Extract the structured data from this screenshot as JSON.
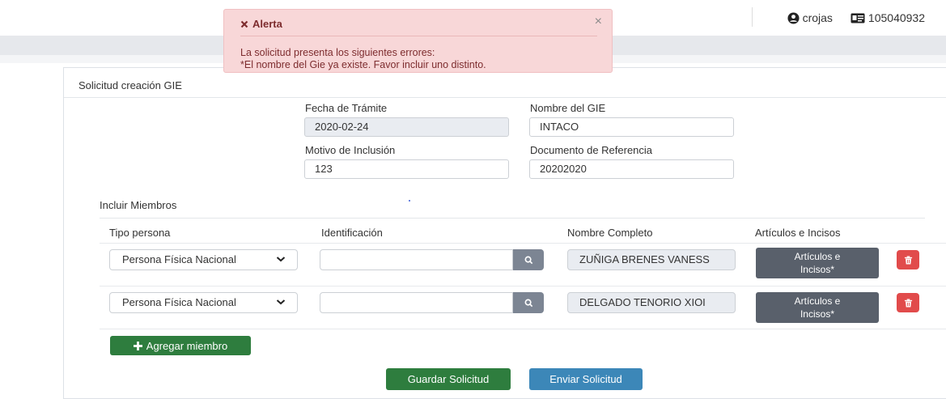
{
  "header": {
    "username": "crojas",
    "id_number": "105040932"
  },
  "alert": {
    "title": "Alerta",
    "close": "×",
    "line1": "La solicitud presenta los siguientes errores:",
    "line2": "*El nombre del Gie ya existe. Favor incluir uno distinto."
  },
  "form": {
    "card_title": "Solicitud creación GIE",
    "fecha_label": "Fecha de Trámite",
    "fecha_value": "2020-02-24",
    "nombre_label": "Nombre del GIE",
    "nombre_value": "INTACO",
    "motivo_label": "Motivo de Inclusión",
    "motivo_value": "123",
    "documento_label": "Documento de Referencia",
    "documento_value": "20202020"
  },
  "members": {
    "title": "Incluir Miembros",
    "headers": [
      "Tipo persona",
      "Identificación",
      "Nombre Completo",
      "Artículos e Incisos"
    ],
    "rows": [
      {
        "tipo": "Persona Física Nacional",
        "nombre": "ZUÑIGA BRENES VANESS",
        "articulos_line1": "Artículos e",
        "articulos_line2": "Incisos*"
      },
      {
        "tipo": "Persona Física Nacional",
        "nombre": "DELGADO TENORIO XIOI",
        "articulos_line1": "Artículos e",
        "articulos_line2": "Incisos*"
      }
    ],
    "add_label": "Agregar miembro"
  },
  "actions": {
    "save": "Guardar Solicitud",
    "send": "Enviar Solicitud"
  },
  "colors": {
    "alert_bg": "#f8d7d8",
    "green": "#2e7d3e",
    "blue": "#3c87b8",
    "danger": "#e14b4b",
    "dark_button": "#59606b"
  }
}
